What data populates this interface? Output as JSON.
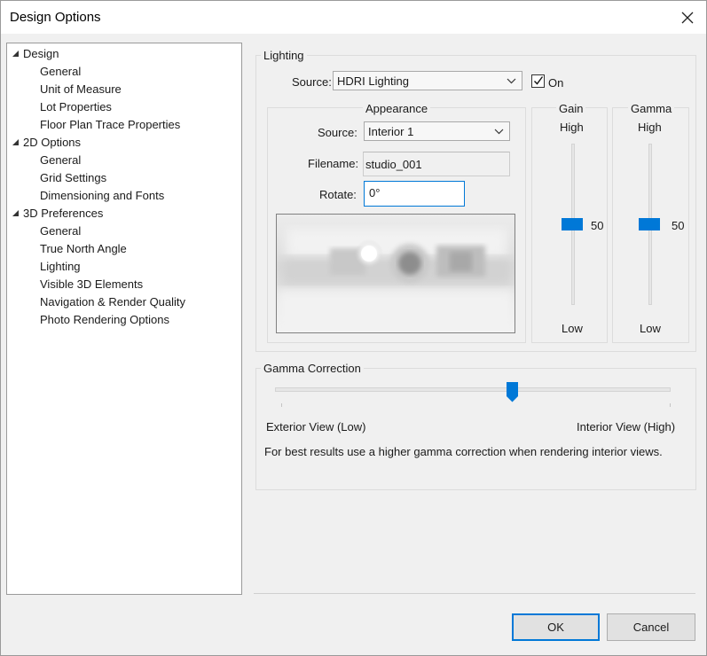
{
  "window": {
    "title": "Design Options"
  },
  "tree": {
    "items": [
      {
        "label": "Design",
        "level": 0,
        "expanded": true
      },
      {
        "label": "General",
        "level": 1
      },
      {
        "label": "Unit of Measure",
        "level": 1
      },
      {
        "label": "Lot Properties",
        "level": 1
      },
      {
        "label": "Floor Plan Trace Properties",
        "level": 1
      },
      {
        "label": "2D Options",
        "level": 0,
        "expanded": true
      },
      {
        "label": "General",
        "level": 1
      },
      {
        "label": "Grid Settings",
        "level": 1
      },
      {
        "label": "Dimensioning and Fonts",
        "level": 1
      },
      {
        "label": "3D Preferences",
        "level": 0,
        "expanded": true
      },
      {
        "label": "General",
        "level": 1
      },
      {
        "label": "True North Angle",
        "level": 1
      },
      {
        "label": "Lighting",
        "level": 1,
        "selected": true
      },
      {
        "label": "Visible 3D Elements",
        "level": 1
      },
      {
        "label": "Navigation & Render Quality",
        "level": 1
      },
      {
        "label": "Photo Rendering Options",
        "level": 1
      }
    ]
  },
  "lighting": {
    "group_label": "Lighting",
    "source_label": "Source:",
    "source_value": "HDRI Lighting",
    "on_label": "On",
    "on_checked": true,
    "appearance": {
      "group_label": "Appearance",
      "source_label": "Source:",
      "source_value": "Interior 1",
      "filename_label": "Filename:",
      "filename_value": "studio_001",
      "rotate_label": "Rotate:",
      "rotate_value": "0°"
    },
    "gain": {
      "label": "Gain",
      "high": "High",
      "low": "Low",
      "value": "50",
      "level": 0.5
    },
    "gamma": {
      "label": "Gamma",
      "high": "High",
      "low": "Low",
      "value": "50",
      "level": 0.5
    }
  },
  "gamma_correction": {
    "group_label": "Gamma Correction",
    "low_label": "Exterior View (Low)",
    "high_label": "Interior View (High)",
    "hint": "For best results use a higher gamma correction when rendering interior views.",
    "level": 0.6
  },
  "buttons": {
    "ok": "OK",
    "cancel": "Cancel"
  },
  "colors": {
    "accent": "#0078d7",
    "selection": "#ffffff"
  }
}
